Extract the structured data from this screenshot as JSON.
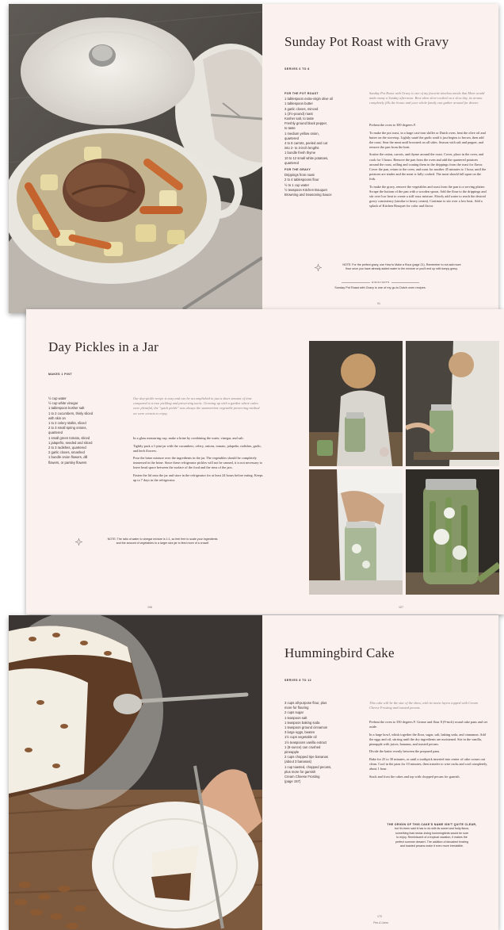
{
  "spreads": [
    {
      "title": "Sunday Pot Roast with Gravy",
      "serves": "SERVES 6 TO 8",
      "ingredient_sections": [
        {
          "heading": "FOR THE POT ROAST",
          "items": [
            "1 tablespoon extra-virgin olive oil",
            "1 tablespoon butter",
            "3 garlic cloves, minced",
            "1 (3½-pound) roast",
            "Kosher salt, to taste",
            "Freshly ground black pepper,",
            "to taste",
            "1 medium yellow onion,",
            "quartered",
            "4 to 6 carrots, peeled and cut",
            "into 2- to 3-inch lengths",
            "1 bundle fresh thyme",
            "10 to 12 small white potatoes,",
            "quartered"
          ]
        },
        {
          "heading": "FOR THE GRAVY",
          "items": [
            "Drippings from roast",
            "2 to 4 tablespoons flour",
            "½ to 1 cup water",
            "½ teaspoon Kitchen Bouquet",
            "Browning and Seasoning Sauce"
          ]
        }
      ],
      "intro": "Sunday Pot Roast with Gravy is one of my favorite timeless meals that Mom would make many a Sunday afternoon. Best when slow-cooked on a slow day, its aroma completely fills the house and your whole family can gather around for dinner.",
      "steps": [
        "Preheat the oven to 300 degrees F.",
        "To make the pot roast, in a large cast-iron skillet or Dutch oven, heat the olive oil and butter on the stovetop. Lightly sauté the garlic until it just begins to brown, then add the roast. Sear the meat until browned on all sides. Season with salt and pepper, and remove the pan from the heat.",
        "Scatter the onion, carrots, and thyme around the roast. Cover, place in the oven, and cook for 3 hours. Remove the pan from the oven and add the quartered potatoes around the roast, rolling and coating them in the drippings from the roast for flavor. Cover the pan, return to the oven, and roast for another 45 minutes to 1 hour, until the potatoes are tender and the meat is fully cooked. The meat should fall apart on the fork.",
        "To make the gravy, remove the vegetables and roast from the pan to a serving platter. Scrape the bottom of the pan with a wooden spoon. Add the flour to the drippings and stir over low heat to create a stiff roux mixture. Slowly add water to reach the desired gravy consistency (similar to heavy cream). Continue to stir over a low heat. Add a splash of Kitchen Bouquet for color and flavor."
      ],
      "note_line_1": "NOTE: For the perfect gravy, use How to Make a Roux (page 21). Remember to not add more",
      "note_line_2": "flour once you have already added water to the mixture or you'll end up with lumpy gravy.",
      "divider_label": "HIGHLIGHTS",
      "caption": "Sunday Pot Roast with Gravy is one of my go-to Dutch oven recipes.",
      "folio": "91"
    },
    {
      "title": "Day Pickles in a Jar",
      "serves": "MAKES 1 PINT",
      "ingredients": [
        "½ cup water",
        "½ cup white vinegar",
        "1 tablespoon kosher salt",
        "1 to 2 cucumbers, thinly sliced",
        "with skin on",
        "1 to 2 celery stalks, sliced",
        "2 to 3 small spring onions,",
        "quartered",
        "1 small green tomato, sliced",
        "1 jalapeño, seeded and sliced",
        "2 to 3 radishes, quartered",
        "2 garlic cloves, smashed",
        "1 bundle onion flowers, dill",
        "flowers, or parsley flowers"
      ],
      "intro": "Our day-pickle recipe is easy and can be accomplished in just a short amount of time compared to a true pickling and preserving tactic. Growing up with a garden where cukes were plentiful, the \"quick pickle\" was always the summertime vegetable preserving method we were certain to enjoy.",
      "steps": [
        "In a glass measuring cup, make a brine by combining the water, vinegar, and salt.",
        "Tightly pack a 1-pint jar with the cucumbers, celery, onions, tomato, jalapeño, radishes, garlic, and herb flowers.",
        "Pour the brine mixture over the ingredients in the jar. The vegetables should be completely immersed in the brine. Since these refrigerator pickles will not be canned, it is not necessary to leave head space between the surface of the food and the rims of the jars.",
        "Fasten the lid onto the jar and store in the refrigerator for at least 24 hours before eating. Keeps up to 7 days in the refrigerator."
      ],
      "note_line_1": "NOTE: The ratio of water to vinegar mixture is 1:1, so feel free to scale your ingredients",
      "note_line_2": "and the amount of vegetables to a larger size jar to feed more of a crowd!",
      "folio_left": "106",
      "folio_right": "107"
    },
    {
      "title": "Hummingbird Cake",
      "serves": "SERVES 8 TO 12",
      "ingredients": [
        "3 cups all-purpose flour, plus",
        "more for flouring",
        "2 cups sugar",
        "1 teaspoon salt",
        "1 teaspoon baking soda",
        "1 teaspoon ground cinnamon",
        "3 large eggs, beaten",
        "1½ cups vegetable oil",
        "1½ teaspoons vanilla extract",
        "1 (8-ounce) can crushed",
        "pineapple",
        "2 cups chopped ripe bananas",
        "(about 3 bananas)",
        "1 cup toasted, chopped pecans,",
        "plus more for garnish",
        "Cream Cheese Frosting",
        "(page 157)"
      ],
      "intro": "This cake will be the star of the show, with its moist layers topped with Cream Cheese Frosting and toasted pecans.",
      "steps": [
        "Preheat the oven to 350 degrees F. Grease and flour 8 (9-inch) round cake pans and set aside.",
        "In a large bowl, whisk together the flour, sugar, salt, baking soda, and cinnamon. Add the eggs and oil, stirring until the dry ingredients are moistened. Stir in the vanilla, pineapple with juices, bananas, and toasted pecans.",
        "Divide the batter evenly between the prepared pans.",
        "Bake for 25 to 30 minutes, or until a toothpick inserted into center of cake comes out clean. Cool in the pans for 10 minutes, then transfer to wire racks and cool completely, about 1 hour.",
        "Stack and frost the cakes and top with chopped pecans for garnish."
      ],
      "note_heading": "THE ORIGIN OF THIS CAKE'S NAME ISN'T QUITE CLEAR,",
      "note_lines": [
        "but it's been said it has to do with its sweet and fruity flavor,",
        "something that nectar-loving hummingbirds would be sure",
        "to enjoy. Reminiscent of a tropical vacation, it makes the",
        "perfect summer dessert. The addition of decadent frosting",
        "and toasted pecans make it even more irresistible."
      ],
      "folio": "170",
      "folio_sub": "Pies & Cakes"
    }
  ]
}
